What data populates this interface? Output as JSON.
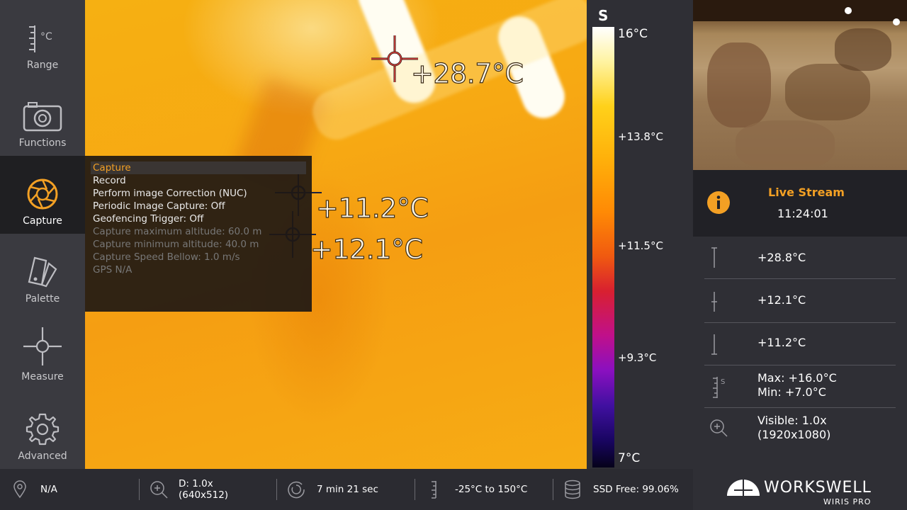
{
  "sidebar": {
    "items": [
      {
        "name": "range",
        "label": "Range",
        "icon": "range-icon",
        "active": false
      },
      {
        "name": "functions",
        "label": "Functions",
        "icon": "camera-icon",
        "active": false
      },
      {
        "name": "capture",
        "label": "Capture",
        "icon": "aperture-icon",
        "active": true
      },
      {
        "name": "palette",
        "label": "Palette",
        "icon": "palette-icon",
        "active": false
      },
      {
        "name": "measure",
        "label": "Measure",
        "icon": "crosshair-icon",
        "active": false
      },
      {
        "name": "advanced",
        "label": "Advanced",
        "icon": "gear-icon",
        "active": false
      }
    ],
    "range_unit": "°C"
  },
  "thermal": {
    "markers": [
      {
        "label": "+28.7°C"
      },
      {
        "label": "+11.2°C"
      },
      {
        "label": "+12.1°C"
      }
    ]
  },
  "capture_menu": {
    "items": [
      {
        "label": "Capture",
        "state": "selected"
      },
      {
        "label": "Record",
        "state": "normal"
      },
      {
        "label": "Perform image Correction (NUC)",
        "state": "normal"
      },
      {
        "label": "Periodic Image Capture: Off",
        "state": "normal"
      },
      {
        "label": "Geofencing Trigger: Off",
        "state": "normal"
      },
      {
        "label": "Capture maximum altitude: 60.0 m",
        "state": "disabled"
      },
      {
        "label": "Capture minimum altitude: 40.0 m",
        "state": "disabled"
      },
      {
        "label": "Capture Speed Bellow: 1.0 m/s",
        "state": "disabled"
      },
      {
        "label": "GPS N/A",
        "state": "disabled"
      }
    ]
  },
  "color_scale": {
    "mode": "S",
    "labels": [
      "16°C",
      "+13.8°C",
      "+11.5°C",
      "+9.3°C",
      "7°C"
    ]
  },
  "right_panel": {
    "live_stream_title": "Live Stream",
    "live_time": "11:24:01",
    "rows": {
      "max_marker": "+28.8°C",
      "mid_marker": "+12.1°C",
      "min_marker": "+11.2°C",
      "range_max": "Max: +16.0°C",
      "range_min": "Min: +7.0°C",
      "visible_zoom": "Visible: 1.0x",
      "visible_res": "(1920x1080)"
    },
    "range_icon_letter": "S"
  },
  "bottom_bar": {
    "gps": "N/A",
    "digital_zoom": "D: 1.0x",
    "digital_res": "(640x512)",
    "recording_time": "7 min 21 sec",
    "temp_range": "-25°C to 150°C",
    "ssd_free": "SSD Free: 99.06%"
  },
  "logo": {
    "brand": "WORKSWELL",
    "product": "WIRIS PRO"
  },
  "colors": {
    "accent": "#f3a024",
    "sidebar_bg": "#3a3a40",
    "panel_bg": "#2f2f35"
  }
}
